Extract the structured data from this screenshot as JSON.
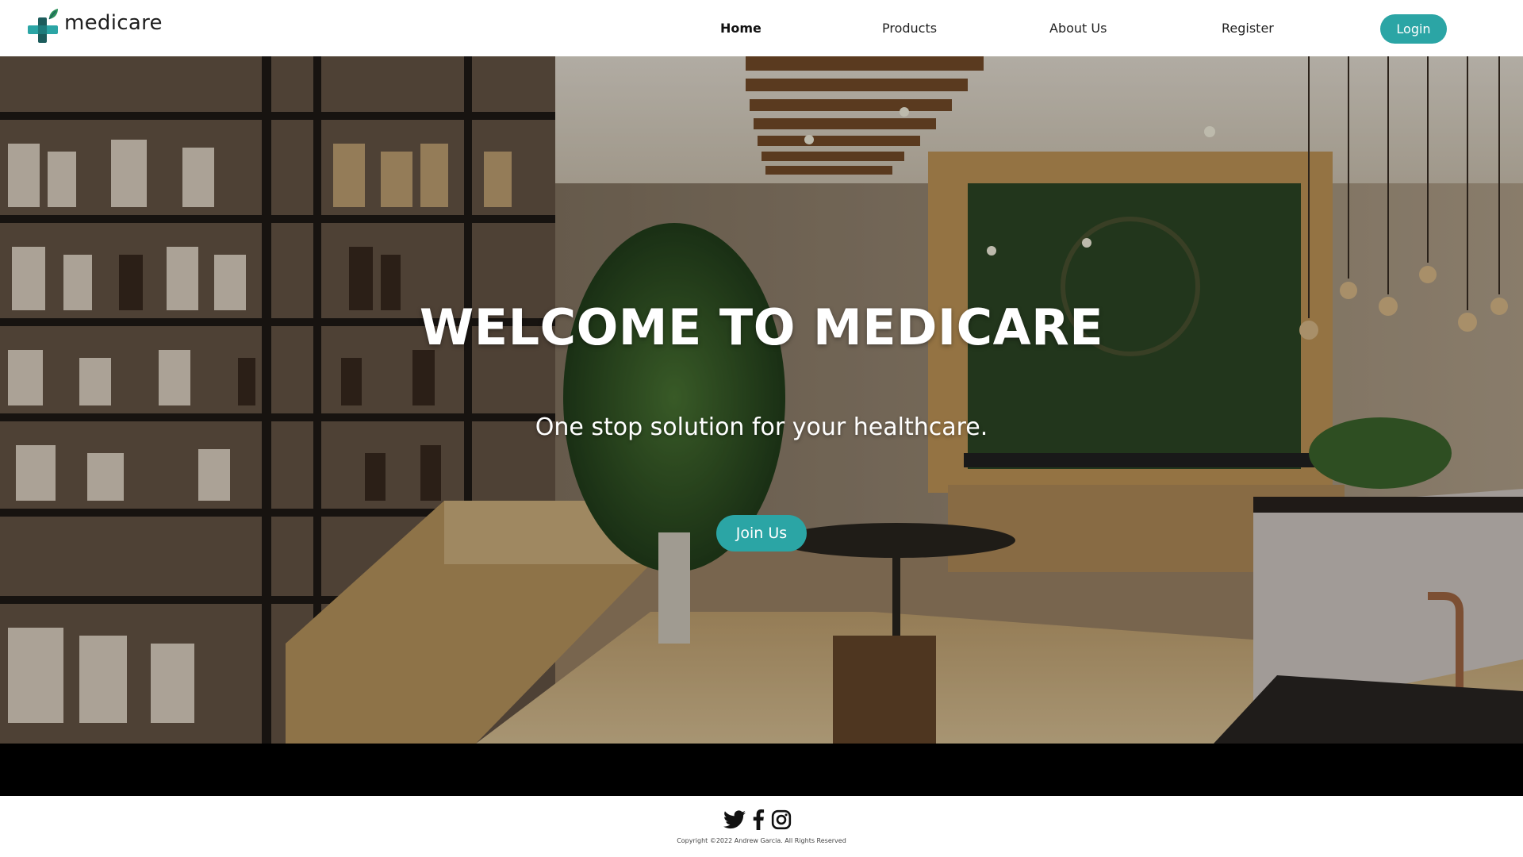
{
  "brand": {
    "name": "medicare",
    "accent": "#2ba5a5"
  },
  "nav": {
    "items": [
      {
        "label": "Home",
        "active": true
      },
      {
        "label": "Products",
        "active": false
      },
      {
        "label": "About Us",
        "active": false
      },
      {
        "label": "Register",
        "active": false
      }
    ],
    "login_label": "Login"
  },
  "hero": {
    "title": "WELCOME TO MEDICARE",
    "subtitle": "One stop solution for your healthcare.",
    "cta_label": "Join Us",
    "background": "pharmacy-interior-photo"
  },
  "footer": {
    "social_icons": [
      "twitter-icon",
      "facebook-icon",
      "instagram-icon"
    ],
    "copyright": "Copyright ©2022 Andrew Garcia. All Rights Reserved"
  }
}
